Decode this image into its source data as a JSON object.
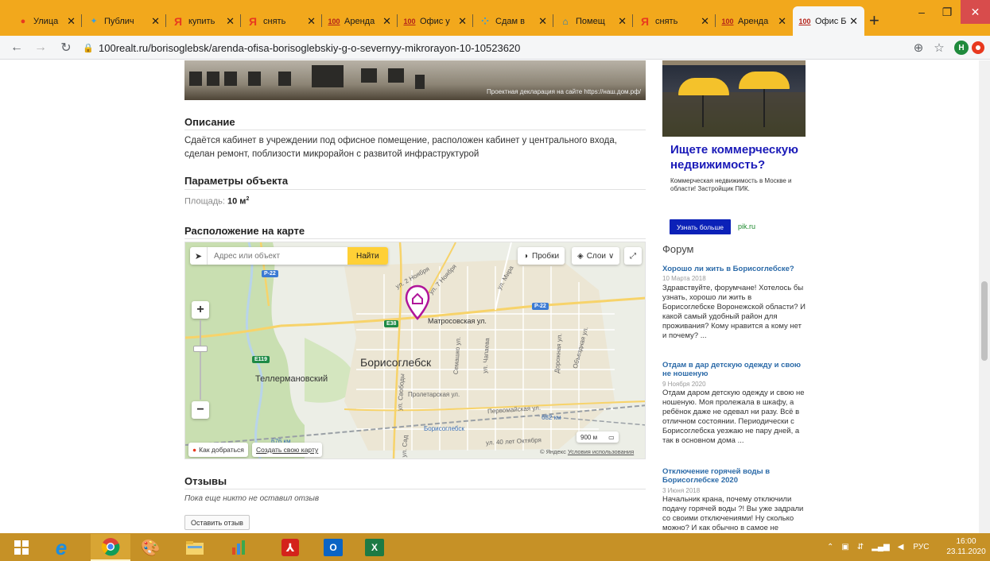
{
  "browser": {
    "tabs": [
      {
        "title": "Улица",
        "icon": "map-pin-icon",
        "active": false
      },
      {
        "title": "Публич",
        "icon": "leaf-icon",
        "active": false
      },
      {
        "title": "купить",
        "icon": "yandex-icon",
        "active": false
      },
      {
        "title": "снять",
        "icon": "yandex-icon",
        "active": false
      },
      {
        "title": "Аренда",
        "icon": "100realt-icon",
        "active": false
      },
      {
        "title": "Офис у",
        "icon": "100realt-icon",
        "active": false
      },
      {
        "title": "Сдам в",
        "icon": "dots-icon",
        "active": false
      },
      {
        "title": "Помещ",
        "icon": "house-icon",
        "active": false
      },
      {
        "title": "снять",
        "icon": "yandex-icon",
        "active": false
      },
      {
        "title": "Аренда",
        "icon": "100realt-icon",
        "active": false
      },
      {
        "title": "Офис Б",
        "icon": "100realt-icon",
        "active": true
      }
    ],
    "url": "100realt.ru/borisoglebsk/arenda-ofisa-borisoglebskiy-g-o-severnyy-mikrorayon-10-10523620",
    "profile_initial": "Н",
    "colors": {
      "titlebar": "#f2a81c",
      "close": "#d84c4c"
    }
  },
  "listing": {
    "photo_caption": "Проектная декларация на сайте https://наш.дом.рф/",
    "description_title": "Описание",
    "description_text": "Сдаётся кабинет в учреждении под офисное помещение, расположен кабинет у центрального входа, сделан ремонт, поблизости микрорайон с развитой инфраструктурой",
    "params_title": "Параметры объекта",
    "area_label": "Площадь:",
    "area_value": "10 м",
    "area_unit_sup": "2",
    "map_title": "Расположение на карте",
    "reviews_title": "Отзывы",
    "no_reviews": "Пока еще никто не оставил отзыв",
    "leave_review": "Оставить отзыв"
  },
  "map": {
    "search_placeholder": "Адрес или объект",
    "find_button": "Найти",
    "traffic": "Пробки",
    "layers": "Слои",
    "route": "Как добраться",
    "create_map": "Создать свою карту",
    "scale": "900 м",
    "copyright": "© Яндекс",
    "terms": "Условия использования",
    "labels": {
      "city": "Борисоглебск",
      "tellerman": "Теллермановский",
      "matrosovskaya": "Матросовская ул.",
      "proletarskaya": "Пролетарская ул.",
      "pervomayskaya": "Первомайская ул.",
      "station": "Борисоглебск",
      "km682": "682 км",
      "km676": "676 км",
      "oktyabrya": "ул. 40 лет Октября",
      "svobody": "ул. Свободы",
      "chapaeva": "ул. Чапаева",
      "dorozhnaya": "Дорожная ул.",
      "semashko": "Семашко ул.",
      "noyabrya2": "ул. 2 Ноября",
      "noyabrya7": "ул. 7 Ноября",
      "mira": "ул. Мира",
      "obyezdnaya": "Объездная ул.",
      "sad": "ул. Сад",
      "r22": "Р-22",
      "e119": "E119",
      "e38": "E38"
    }
  },
  "ad": {
    "title": "Ищете коммерческую недвижимость?",
    "text": "Коммерческая недвижимость в Москве и области! Застройщик ПИК.",
    "button": "Узнать больше",
    "link": "pik.ru"
  },
  "forum": {
    "heading": "Форум",
    "posts": [
      {
        "title": "Хорошо ли жить в Борисоглебске?",
        "date": "10 Марта 2018",
        "text": "Здравствуйте, форумчане! Хотелось бы узнать, хорошо ли жить в Борисоглебске Воронежской области? И какой самый удобный район для проживания? Кому нравится а кому нет и почему? ..."
      },
      {
        "title": "Отдам в дар детскую одежду и свою не ношеную",
        "date": "9 Ноября 2020",
        "text": "Отдам даром детскую одежду и свою не ношеную. Моя пролежала в шкафу, а ребёнок даже не одевал ни разу. Всё в отличном состоянии. Периодически с Борисоглебска уезжаю не пару дней, а так в основном дома ..."
      },
      {
        "title": "Отключение горячей воды в Борисоглебске 2020",
        "date": "3 Июня 2018",
        "text": "Начальник крана, почему отключили подачу горячей воды ?! Вы уже задрали со своими отключениями! Ну сколько можно? И как обычно в самое не"
      }
    ]
  },
  "taskbar": {
    "lang": "РУС",
    "time": "16:00",
    "date": "23.11.2020"
  }
}
